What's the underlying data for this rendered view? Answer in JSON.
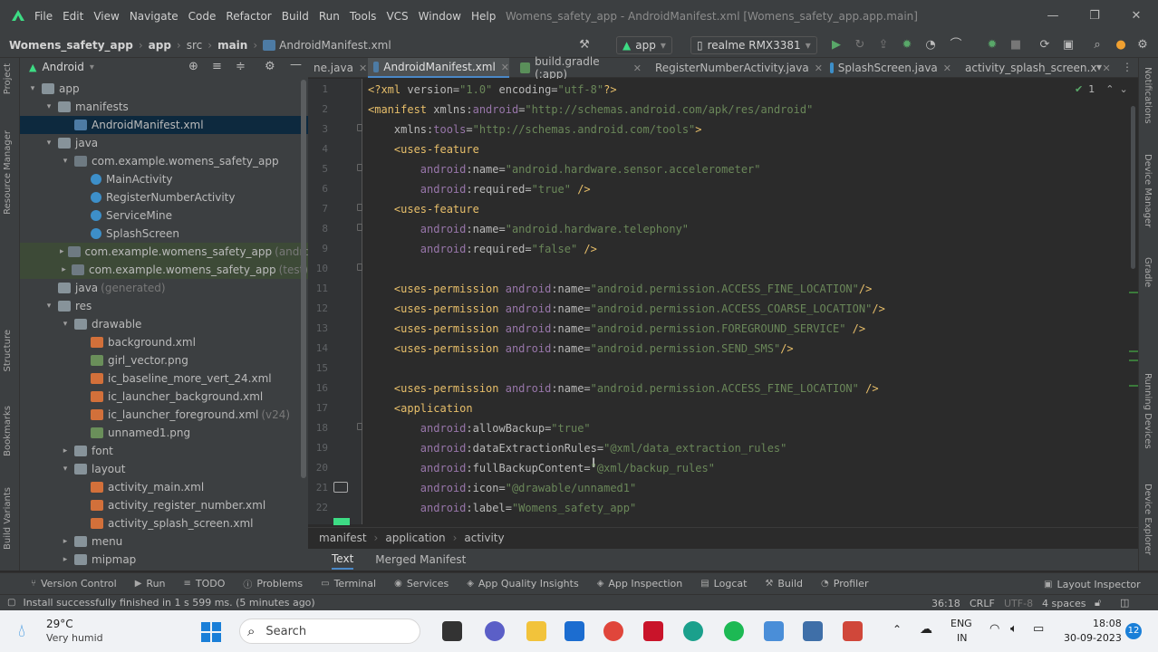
{
  "menu": [
    "File",
    "Edit",
    "View",
    "Navigate",
    "Code",
    "Refactor",
    "Build",
    "Run",
    "Tools",
    "VCS",
    "Window",
    "Help"
  ],
  "window_title": "Womens_safety_app - AndroidManifest.xml [Womens_safety_app.app.main]",
  "breadcrumb": [
    "Womens_safety_app",
    "app",
    "src",
    "main",
    "AndroidManifest.xml"
  ],
  "run_config": "app",
  "device": "realme RMX3381",
  "project_view": "Android",
  "tree": [
    {
      "label": "app",
      "depth": 0,
      "icon": "folder",
      "arrow": "▾"
    },
    {
      "label": "manifests",
      "depth": 1,
      "icon": "folder",
      "arrow": "▾"
    },
    {
      "label": "AndroidManifest.xml",
      "depth": 2,
      "icon": "manif",
      "arrow": "",
      "state": "sel"
    },
    {
      "label": "java",
      "depth": 1,
      "icon": "folder",
      "arrow": "▾"
    },
    {
      "label": "com.example.womens_safety_app",
      "depth": 2,
      "icon": "pkg",
      "arrow": "▾"
    },
    {
      "label": "MainActivity",
      "depth": 3,
      "icon": "cls",
      "arrow": ""
    },
    {
      "label": "RegisterNumberActivity",
      "depth": 3,
      "icon": "cls",
      "arrow": ""
    },
    {
      "label": "ServiceMine",
      "depth": 3,
      "icon": "cls",
      "arrow": ""
    },
    {
      "label": "SplashScreen",
      "depth": 3,
      "icon": "cls",
      "arrow": ""
    },
    {
      "label": "com.example.womens_safety_app",
      "depth": 2,
      "icon": "pkg",
      "arrow": "▸",
      "suffix": "(androidTest)",
      "state": "hl"
    },
    {
      "label": "com.example.womens_safety_app",
      "depth": 2,
      "icon": "pkg",
      "arrow": "▸",
      "suffix": "(test)",
      "state": "hl"
    },
    {
      "label": "java",
      "depth": 1,
      "icon": "folder",
      "arrow": "",
      "suffix": "(generated)"
    },
    {
      "label": "res",
      "depth": 1,
      "icon": "folder",
      "arrow": "▾"
    },
    {
      "label": "drawable",
      "depth": 2,
      "icon": "folder",
      "arrow": "▾"
    },
    {
      "label": "background.xml",
      "depth": 3,
      "icon": "xml",
      "arrow": ""
    },
    {
      "label": "girl_vector.png",
      "depth": 3,
      "icon": "png",
      "arrow": ""
    },
    {
      "label": "ic_baseline_more_vert_24.xml",
      "depth": 3,
      "icon": "xml",
      "arrow": ""
    },
    {
      "label": "ic_launcher_background.xml",
      "depth": 3,
      "icon": "xml",
      "arrow": ""
    },
    {
      "label": "ic_launcher_foreground.xml",
      "depth": 3,
      "icon": "xml",
      "arrow": "",
      "suffix": "(v24)"
    },
    {
      "label": "unnamed1.png",
      "depth": 3,
      "icon": "png",
      "arrow": ""
    },
    {
      "label": "font",
      "depth": 2,
      "icon": "folder",
      "arrow": "▸"
    },
    {
      "label": "layout",
      "depth": 2,
      "icon": "folder",
      "arrow": "▾"
    },
    {
      "label": "activity_main.xml",
      "depth": 3,
      "icon": "xml",
      "arrow": ""
    },
    {
      "label": "activity_register_number.xml",
      "depth": 3,
      "icon": "xml",
      "arrow": ""
    },
    {
      "label": "activity_splash_screen.xml",
      "depth": 3,
      "icon": "xml",
      "arrow": ""
    },
    {
      "label": "menu",
      "depth": 2,
      "icon": "folder",
      "arrow": "▸"
    },
    {
      "label": "mipmap",
      "depth": 2,
      "icon": "folder",
      "arrow": "▸"
    }
  ],
  "tabs": [
    {
      "label": "ne.java",
      "color": "#3d8fc9"
    },
    {
      "label": "AndroidManifest.xml",
      "color": "#4d7ba4",
      "active": true
    },
    {
      "label": "build.gradle (:app)",
      "color": "#5a8f5a"
    },
    {
      "label": "RegisterNumberActivity.java",
      "color": "#3d8fc9"
    },
    {
      "label": "SplashScreen.java",
      "color": "#3d8fc9"
    },
    {
      "label": "activity_splash_screen.x",
      "color": "#d2703a"
    }
  ],
  "code": [
    [
      [
        "c-pi",
        "<?xml "
      ],
      [
        "c-attr",
        "version="
      ],
      [
        "c-str",
        "\"1.0\""
      ],
      [
        "c-attr",
        " encoding="
      ],
      [
        "c-str",
        "\"utf-8\""
      ],
      [
        "c-pi",
        "?>"
      ]
    ],
    [
      [
        "c-def",
        "<manifest "
      ],
      [
        "c-attr",
        "xmlns:"
      ],
      [
        "c-ns",
        "android"
      ],
      [
        "c-attr",
        "="
      ],
      [
        "c-str",
        "\"http://schemas.android.com/apk/res/android\""
      ]
    ],
    [
      [
        "c-plain",
        "    "
      ],
      [
        "c-attr",
        "xmlns:"
      ],
      [
        "c-ns",
        "tools"
      ],
      [
        "c-attr",
        "="
      ],
      [
        "c-str",
        "\"http://schemas.android.com/tools\""
      ],
      [
        "c-def",
        ">"
      ]
    ],
    [
      [
        "c-plain",
        "    "
      ],
      [
        "c-def",
        "<uses-feature"
      ]
    ],
    [
      [
        "c-plain",
        "        "
      ],
      [
        "c-ns",
        "android"
      ],
      [
        "c-attr",
        ":name="
      ],
      [
        "c-str",
        "\"android.hardware.sensor.accelerometer\""
      ]
    ],
    [
      [
        "c-plain",
        "        "
      ],
      [
        "c-ns",
        "android"
      ],
      [
        "c-attr",
        ":required="
      ],
      [
        "c-str",
        "\"true\""
      ],
      [
        "c-def",
        " />"
      ]
    ],
    [
      [
        "c-plain",
        "    "
      ],
      [
        "c-def",
        "<uses-feature"
      ]
    ],
    [
      [
        "c-plain",
        "        "
      ],
      [
        "c-ns",
        "android"
      ],
      [
        "c-attr",
        ":name="
      ],
      [
        "c-str",
        "\"android.hardware.telephony\""
      ]
    ],
    [
      [
        "c-plain",
        "        "
      ],
      [
        "c-ns",
        "android"
      ],
      [
        "c-attr",
        ":required="
      ],
      [
        "c-str",
        "\"false\""
      ],
      [
        "c-def",
        " />"
      ]
    ],
    [],
    [
      [
        "c-plain",
        "    "
      ],
      [
        "c-def",
        "<uses-permission "
      ],
      [
        "c-ns",
        "android"
      ],
      [
        "c-attr",
        ":name="
      ],
      [
        "c-str",
        "\"android.permission.ACCESS_FINE_LOCATION\""
      ],
      [
        "c-def",
        "/>"
      ]
    ],
    [
      [
        "c-plain",
        "    "
      ],
      [
        "c-def",
        "<uses-permission "
      ],
      [
        "c-ns",
        "android"
      ],
      [
        "c-attr",
        ":name="
      ],
      [
        "c-str",
        "\"android.permission.ACCESS_COARSE_LOCATION\""
      ],
      [
        "c-def",
        "/>"
      ]
    ],
    [
      [
        "c-plain",
        "    "
      ],
      [
        "c-def",
        "<uses-permission "
      ],
      [
        "c-ns",
        "android"
      ],
      [
        "c-attr",
        ":name="
      ],
      [
        "c-str",
        "\"android.permission.FOREGROUND_SERVICE\""
      ],
      [
        "c-def",
        " />"
      ]
    ],
    [
      [
        "c-plain",
        "    "
      ],
      [
        "c-def",
        "<uses-permission "
      ],
      [
        "c-ns",
        "android"
      ],
      [
        "c-attr",
        ":name="
      ],
      [
        "c-str",
        "\"android.permission.SEND_SMS\""
      ],
      [
        "c-def",
        "/>"
      ]
    ],
    [],
    [
      [
        "c-plain",
        "    "
      ],
      [
        "c-def",
        "<uses-permission "
      ],
      [
        "c-ns",
        "android"
      ],
      [
        "c-attr",
        ":name="
      ],
      [
        "c-str",
        "\"android.permission.ACCESS_FINE_LOCATION\""
      ],
      [
        "c-def",
        " />"
      ]
    ],
    [
      [
        "c-plain",
        "    "
      ],
      [
        "c-def",
        "<application"
      ]
    ],
    [
      [
        "c-plain",
        "        "
      ],
      [
        "c-ns",
        "android"
      ],
      [
        "c-attr",
        ":allowBackup="
      ],
      [
        "c-str",
        "\"true\""
      ]
    ],
    [
      [
        "c-plain",
        "        "
      ],
      [
        "c-ns",
        "android"
      ],
      [
        "c-attr",
        ":dataExtractionRules="
      ],
      [
        "c-str",
        "\"@xml/data_extraction_rules\""
      ]
    ],
    [
      [
        "c-plain",
        "        "
      ],
      [
        "c-ns",
        "android"
      ],
      [
        "c-attr",
        ":fullBackupContent="
      ],
      [
        "c-str",
        "\"@xml/backup_rules\""
      ]
    ],
    [
      [
        "c-plain",
        "        "
      ],
      [
        "c-ns",
        "android"
      ],
      [
        "c-attr",
        ":icon="
      ],
      [
        "c-str",
        "\"@drawable/unnamed1\""
      ]
    ],
    [
      [
        "c-plain",
        "        "
      ],
      [
        "c-ns",
        "android"
      ],
      [
        "c-attr",
        ":label="
      ],
      [
        "c-str",
        "\"Womens_safety_app\""
      ]
    ]
  ],
  "editor_breadcrumb": [
    "manifest",
    "application",
    "activity"
  ],
  "editor_modes": [
    "Text",
    "Merged Manifest"
  ],
  "inspection_count": "1",
  "tool_windows": [
    "Version Control",
    "Run",
    "TODO",
    "Problems",
    "Terminal",
    "Services",
    "App Quality Insights",
    "App Inspection",
    "Logcat",
    "Build",
    "Profiler"
  ],
  "layout_inspector": "Layout Inspector",
  "left_strip": [
    "Project",
    "Resource Manager",
    "Structure",
    "Bookmarks",
    "Build Variants"
  ],
  "right_strip": [
    "Notifications",
    "Device Manager",
    "Gradle",
    "Running Devices",
    "Device Explorer"
  ],
  "status": {
    "message": "Install successfully finished in 1 s 599 ms. (5 minutes ago)",
    "position": "36:18",
    "line_sep": "CRLF",
    "encoding": "UTF-8",
    "indent": "4 spaces"
  },
  "taskbar": {
    "temp": "29°C",
    "weather": "Very humid",
    "search_placeholder": "Search",
    "lang": "ENG",
    "region": "IN",
    "time": "18:08",
    "date": "30-09-2023",
    "notif_count": "12"
  }
}
